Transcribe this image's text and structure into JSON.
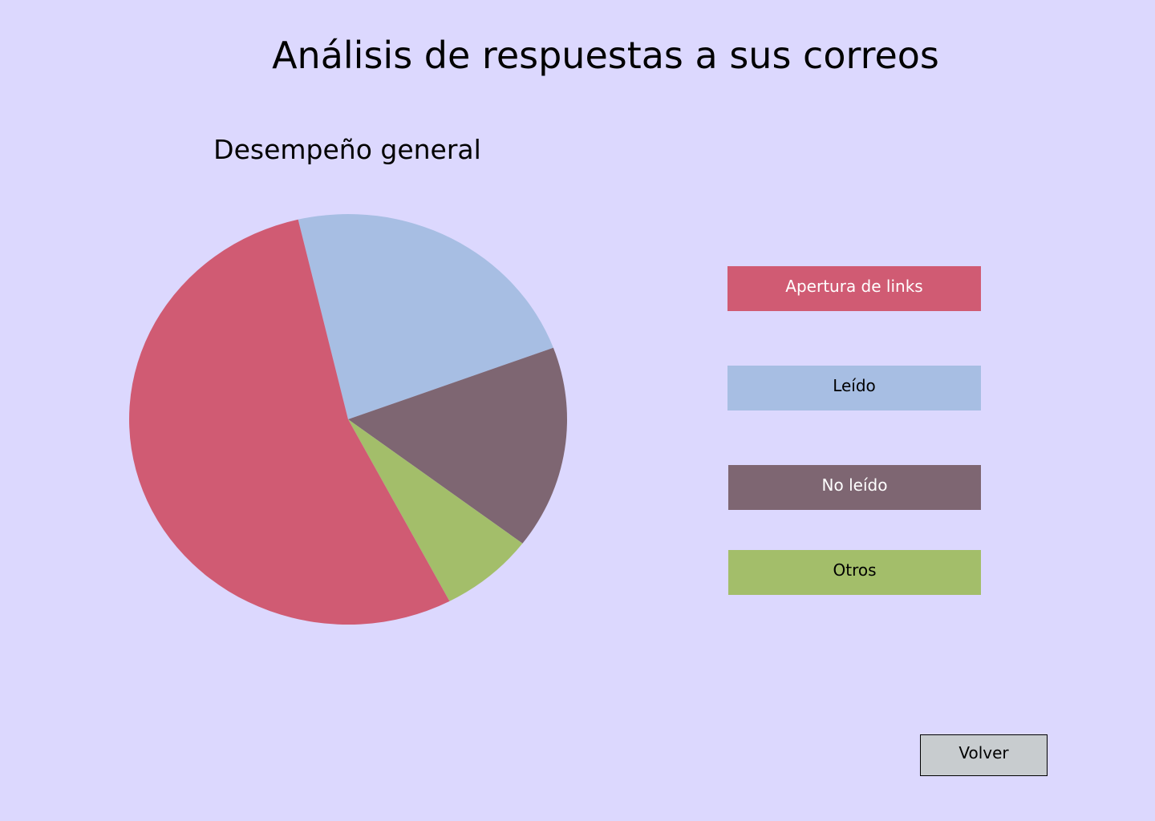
{
  "page": {
    "title": "Análisis de respuestas a sus correos",
    "background_color": "#DCD8FE"
  },
  "chart_data": {
    "type": "pie",
    "title": "Desempeño general",
    "legend_position": "right",
    "slices": [
      {
        "label": "Apertura de links",
        "value": 54,
        "color": "#D05B73",
        "text_color": "#FFFFFF"
      },
      {
        "label": "Leído",
        "value": 23,
        "color": "#A7BEE3",
        "text_color": "#000000"
      },
      {
        "label": "No leído",
        "value": 16,
        "color": "#7E6672",
        "text_color": "#FFFFFF"
      },
      {
        "label": "Otros",
        "value": 7,
        "color": "#A3BE6A",
        "text_color": "#000000"
      }
    ]
  },
  "actions": {
    "back_label": "Volver"
  }
}
